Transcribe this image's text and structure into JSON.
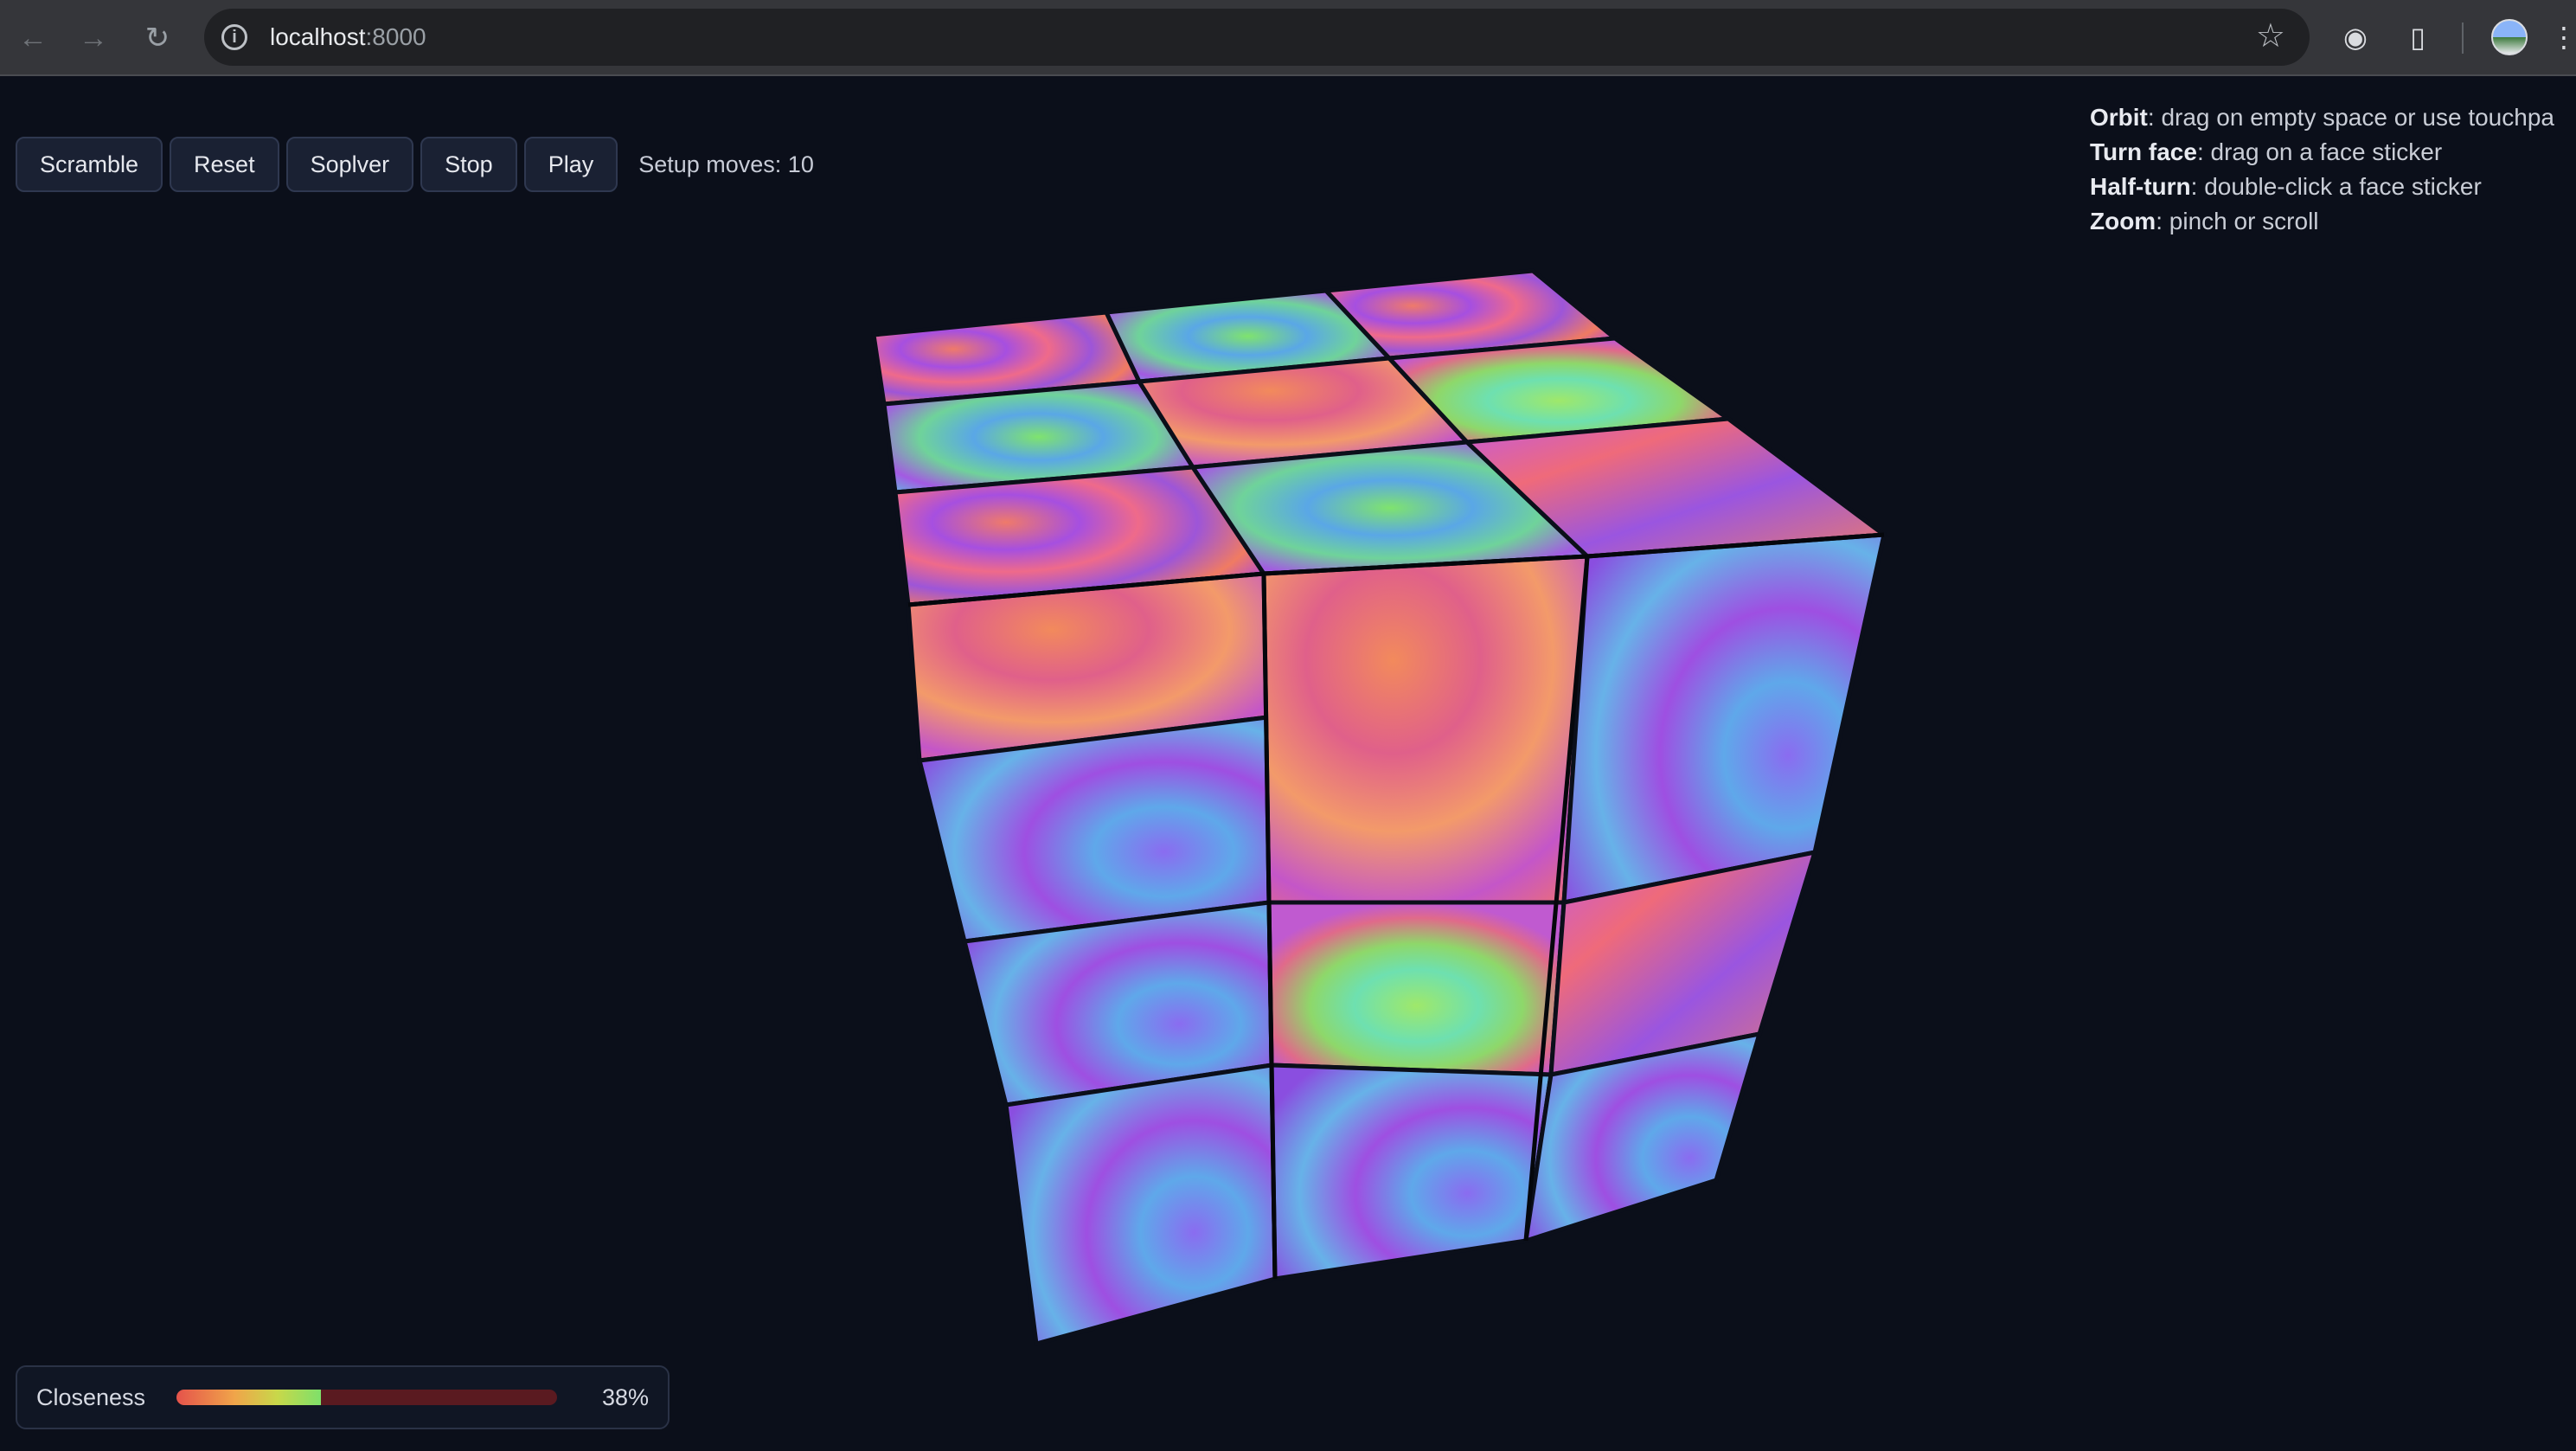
{
  "browser": {
    "url_host": "localhost",
    "url_port": ":8000"
  },
  "toolbar": {
    "buttons": [
      "Scramble",
      "Reset",
      "Soplver",
      "Stop",
      "Play"
    ],
    "setup_moves": "Setup moves: 10"
  },
  "help": {
    "lines": [
      {
        "key": "Orbit",
        "text": ": drag on empty space or use touchpa"
      },
      {
        "key": "Turn face",
        "text": ": drag on a face sticker"
      },
      {
        "key": "Half-turn",
        "text": ": double-click a face sticker"
      },
      {
        "key": "Zoom",
        "text": ": pinch or scroll"
      }
    ]
  },
  "closeness": {
    "label": "Closeness",
    "value": 0.38,
    "percent_text": "38%"
  },
  "colors": {
    "background": "#0b0f1a",
    "sticker_palette": [
      "#a34fe0",
      "#ef6a7a",
      "#6fcf8a",
      "#5aa7e6",
      "#d874c8",
      "#9ee36b"
    ]
  }
}
